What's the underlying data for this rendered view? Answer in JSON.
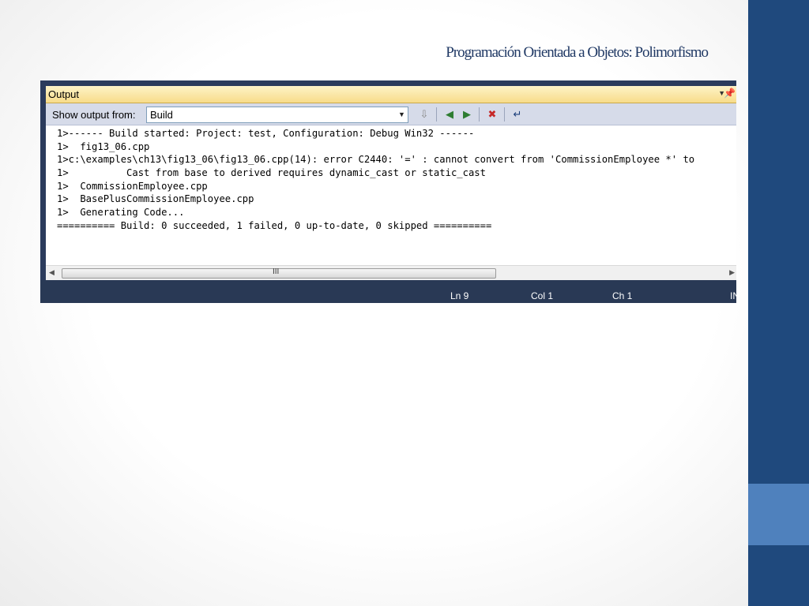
{
  "slide": {
    "title": "Programación Orientada a Objetos: Polimorfismo"
  },
  "output_panel": {
    "title": "Output",
    "show_output_label": "Show output from:",
    "source_value": "Build",
    "lines": [
      "1>------ Build started: Project: test, Configuration: Debug Win32 ------",
      "1>  fig13_06.cpp",
      "1>c:\\examples\\ch13\\fig13_06\\fig13_06.cpp(14): error C2440: '=' : cannot convert from 'CommissionEmployee *' to",
      "1>          Cast from base to derived requires dynamic_cast or static_cast",
      "1>  CommissionEmployee.cpp",
      "1>  BasePlusCommissionEmployee.cpp",
      "1>  Generating Code...",
      "========== Build: 0 succeeded, 1 failed, 0 up-to-date, 0 skipped =========="
    ]
  },
  "icons": {
    "dropdown": "chevron-down-icon",
    "pin": "pin-icon",
    "goto": "go-to-location-icon",
    "prev": "previous-message-icon",
    "next": "next-message-icon",
    "clear": "clear-all-icon",
    "wrap": "word-wrap-icon"
  },
  "status": {
    "ln": "Ln 9",
    "col": "Col 1",
    "ch": "Ch 1",
    "ins": "IN"
  },
  "colors": {
    "band": "#1f497d",
    "accent": "#4f81bd",
    "statusbar": "#293955",
    "title_text": "#1f3864"
  }
}
